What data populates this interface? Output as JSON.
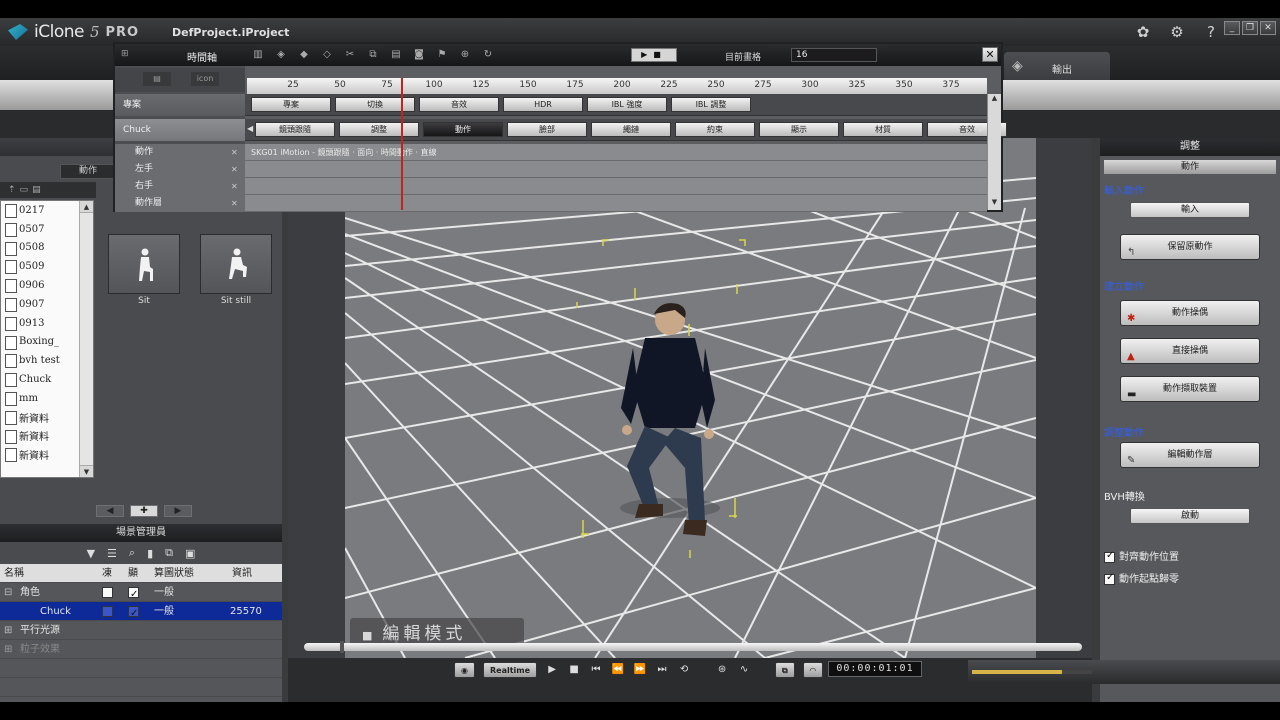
{
  "app": {
    "logo_name": "iClone",
    "logo_version": "5",
    "logo_edition": "PRO",
    "project": "DefProject.iProject"
  },
  "toolbar": {
    "export_label": "輸出"
  },
  "left_panel": {
    "subtab_label": "動作",
    "folders": [
      "0217",
      "0507",
      "0508",
      "0509",
      "0906",
      "0907",
      "0913",
      "Boxing_",
      "bvh test",
      "Chuck",
      "mm",
      "新資料",
      "新資料",
      "新資料"
    ],
    "thumbnails": [
      {
        "label": "Sit"
      },
      {
        "label": "Sit still"
      }
    ]
  },
  "scene_manager": {
    "title": "場景管理員",
    "columns": [
      "名稱",
      "凍",
      "顯",
      "算圖狀態",
      "資訊"
    ],
    "rows": [
      {
        "name": "角色",
        "freeze": false,
        "visible": true,
        "render": "一般",
        "info": ""
      },
      {
        "name": "Chuck",
        "freeze": false,
        "visible": true,
        "render": "一般",
        "info": "25570"
      },
      {
        "name": "平行光源",
        "freeze": false,
        "visible": false,
        "render": "",
        "info": ""
      },
      {
        "name": "粒子效果",
        "freeze": false,
        "visible": false,
        "render": "",
        "info": ""
      }
    ]
  },
  "timeline": {
    "title": "時間軸",
    "frame_label": "目前畫格",
    "frame_value": "16",
    "ruler": [
      "25",
      "50",
      "75",
      "100",
      "125",
      "150",
      "175",
      "200",
      "225",
      "250",
      "275",
      "300",
      "325",
      "350",
      "375"
    ],
    "left_header_tab": "icon",
    "project_row": {
      "label": "專案",
      "tags": [
        "專案",
        "切換",
        "音效",
        "HDR",
        "IBL 強度",
        "IBL 調整"
      ]
    },
    "object_row": {
      "label": "Chuck",
      "tags": [
        "鏡頭跟隨",
        "調整",
        "動作",
        "臉部",
        "繩鏈",
        "約束",
        "顯示",
        "材質",
        "音效"
      ],
      "active_tag": "動作"
    },
    "sub_rows": [
      {
        "label": "動作",
        "clip": "SKG01 iMotion - 鏡頭跟隨 · 面向 · 時間動作 · 直線"
      },
      {
        "label": "左手",
        "clip": ""
      },
      {
        "label": "右手",
        "clip": ""
      },
      {
        "label": "動作層",
        "clip": ""
      }
    ]
  },
  "viewport": {
    "mode_label": "編輯模式",
    "mode_marker": "■"
  },
  "right_panel": {
    "title": "調整",
    "subtitle": "動作",
    "section_import": "輸入動作",
    "btn_import": "輸入",
    "btn_reset": "保留原動作",
    "section_create": "建立動作",
    "btn_puppet": "動作操偶",
    "btn_direct": "直接操偶",
    "btn_mocap": "動作擷取裝置",
    "section_edit": "調整動作",
    "btn_edit_layer": "編輯動作層",
    "section_bvh": "BVH轉換",
    "btn_bvh": "啟動",
    "check_align": "對齊動作位置",
    "check_loop": "動作起點歸零",
    "check_align_on": true,
    "check_loop_on": true
  },
  "transport": {
    "realtime_label": "Realtime",
    "time_display": "00:00:01:01",
    "scrub_fraction": 0.046,
    "render_progress": 0.75
  },
  "colors": {
    "accent_blue": "#2f5ff0",
    "selection": "#0e2a98",
    "playhead": "#c4221a"
  }
}
